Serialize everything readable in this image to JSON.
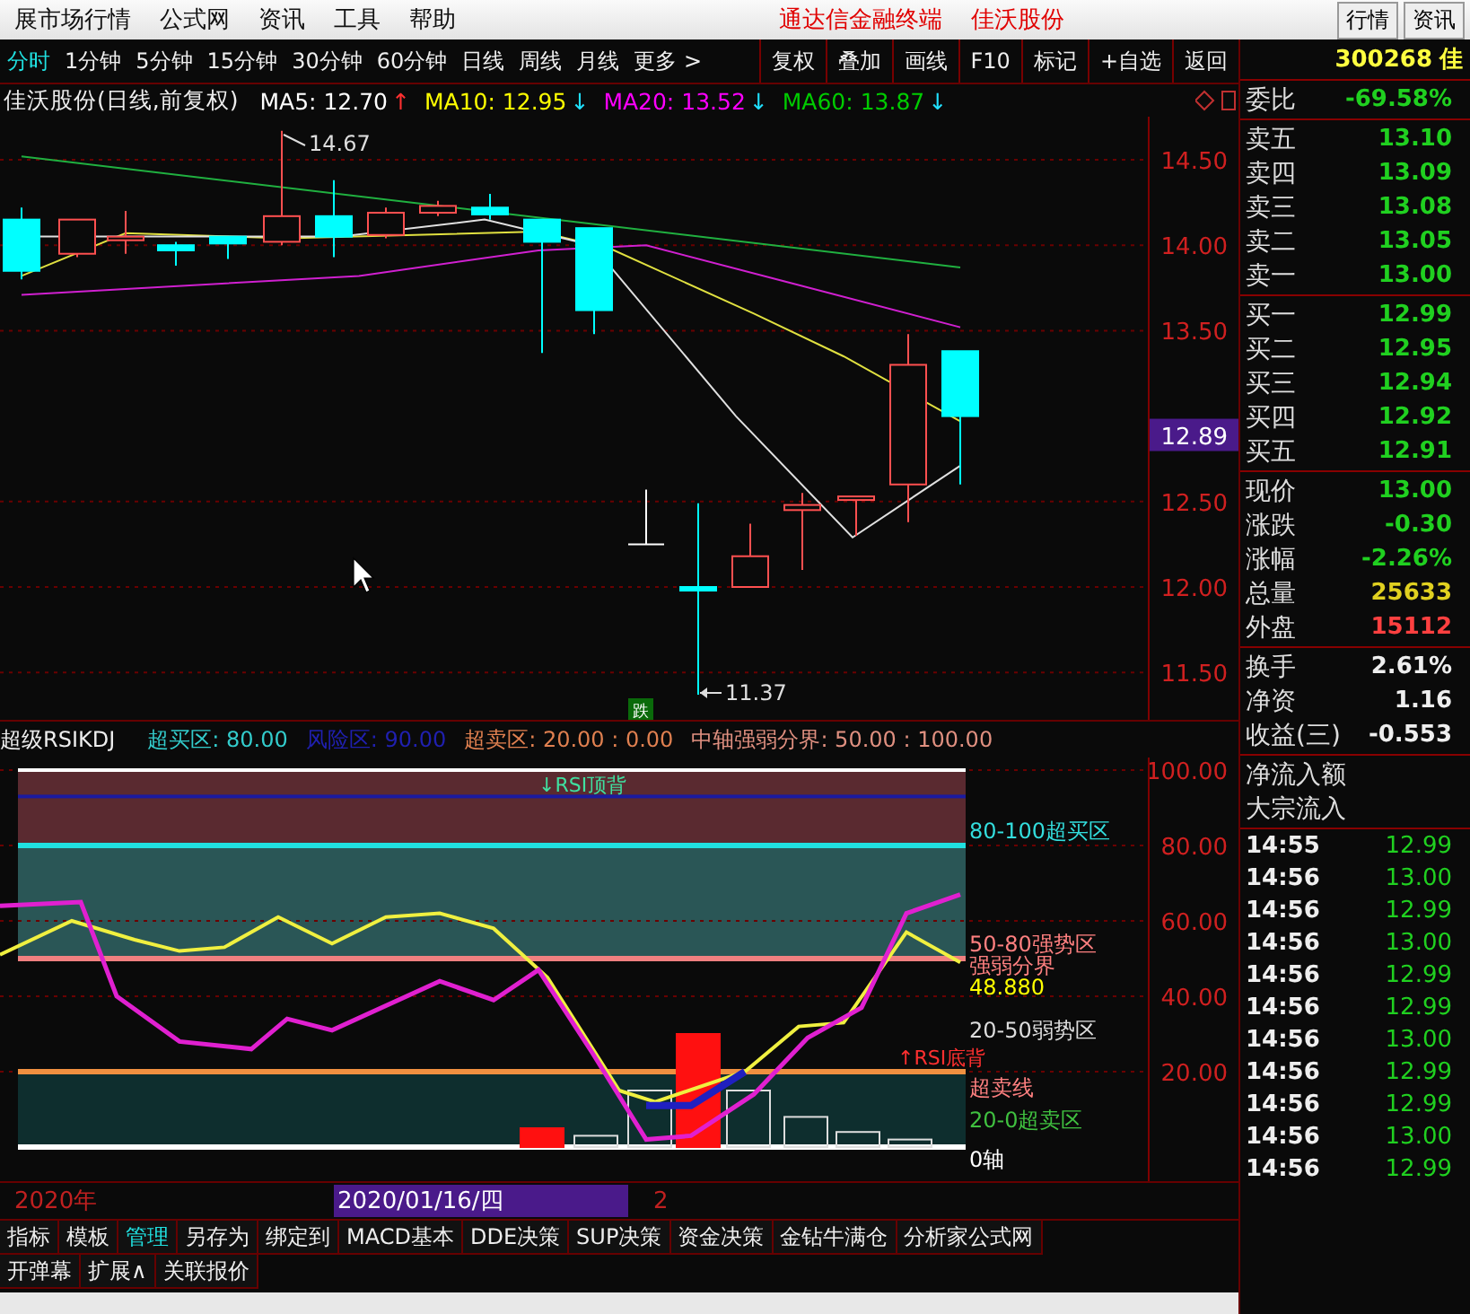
{
  "menu": {
    "items": [
      "展市场行情",
      "公式网",
      "资讯",
      "工具",
      "帮助"
    ],
    "title_parts": [
      "通达信金融终端",
      "佳沃股份"
    ],
    "right_buttons": [
      "行情",
      "资讯"
    ]
  },
  "toolbar": {
    "periods": [
      {
        "label": "分时",
        "selected": true
      },
      {
        "label": "1分钟",
        "selected": false
      },
      {
        "label": "5分钟",
        "selected": false
      },
      {
        "label": "15分钟",
        "selected": false
      },
      {
        "label": "30分钟",
        "selected": false
      },
      {
        "label": "60分钟",
        "selected": false
      },
      {
        "label": "日线",
        "selected": false
      },
      {
        "label": "周线",
        "selected": false
      },
      {
        "label": "月线",
        "selected": false
      },
      {
        "label": "更多 >",
        "selected": false
      }
    ],
    "buttons": [
      "复权",
      "叠加",
      "画线",
      "F10",
      "标记",
      "+自选",
      "返回"
    ]
  },
  "chart_header": {
    "title": "佳沃股份(日线,前复权)",
    "mas": [
      {
        "label": "MA5: 12.70",
        "color": "#ffffff",
        "arrow": {
          "text": "↑",
          "color": "#ff3030"
        }
      },
      {
        "label": "MA10: 12.95",
        "color": "#ffff00",
        "arrow": {
          "text": "↓",
          "color": "#20e0ff"
        }
      },
      {
        "label": "MA20: 13.52",
        "color": "#ff00ff",
        "arrow": {
          "text": "↓",
          "color": "#20e0ff"
        }
      },
      {
        "label": "MA60: 13.87",
        "color": "#00cc00",
        "arrow": {
          "text": "↓",
          "color": "#20e0ff"
        }
      }
    ]
  },
  "main_chart": {
    "price_axis": [
      "14.50",
      "14.00",
      "13.50",
      "12.50",
      "12.00",
      "11.50"
    ],
    "current_price": "12.89",
    "high_label": "14.67",
    "low_label": "11.37",
    "signal_badge": "跌"
  },
  "indicator": {
    "name": "超级RSIKDJ",
    "params": [
      {
        "text": "超买区: 80.00",
        "color": "#33cccc"
      },
      {
        "text": "风险区: 90.00",
        "color": "#2020b0"
      },
      {
        "text": "超卖区: 20.00 : 0.00",
        "color": "#e08050"
      },
      {
        "text": "中轴强弱分界: 50.00 : 100.00",
        "color": "#e09080"
      }
    ],
    "axis": [
      "100.00",
      "80.00",
      "60.00",
      "40.00",
      "20.00"
    ],
    "zone_labels": [
      {
        "text": "80-100超买区",
        "color": "#33dddd"
      },
      {
        "text": "50-80强势区",
        "color": "#ff8080"
      },
      {
        "text": "强弱分界",
        "color": "#ff8080"
      },
      {
        "text": "48.880",
        "color": "#ffff00"
      },
      {
        "text": "20-50弱势区",
        "color": "#dddddd"
      },
      {
        "text": "超卖线",
        "color": "#ff8080"
      },
      {
        "text": "20-0超卖区",
        "color": "#40c040"
      },
      {
        "text": "0轴",
        "color": "#ffffff"
      }
    ],
    "signals": [
      {
        "text": "↓RSI顶背",
        "kind": "top"
      },
      {
        "text": "↑RSI底背",
        "kind": "bottom"
      }
    ]
  },
  "date_bar": {
    "year": "2020年",
    "cursor_date": "2020/01/16/四",
    "mark": "2"
  },
  "bottom_tabs": [
    [
      {
        "label": "指标",
        "selected": false
      },
      {
        "label": "模板",
        "selected": false
      },
      {
        "label": "管理",
        "selected": true
      },
      {
        "label": "另存为",
        "selected": false
      },
      {
        "label": "绑定到",
        "selected": false
      },
      {
        "label": "MACD基本",
        "selected": false
      },
      {
        "label": "DDE决策",
        "selected": false
      },
      {
        "label": "SUP决策",
        "selected": false
      },
      {
        "label": "资金决策",
        "selected": false
      },
      {
        "label": "金钻牛满仓",
        "selected": false
      },
      {
        "label": "分析家公式网",
        "selected": false
      }
    ],
    [
      {
        "label": "开弹幕",
        "selected": false
      },
      {
        "label": "扩展∧",
        "selected": false
      },
      {
        "label": "关联报价",
        "selected": false
      }
    ]
  ],
  "quote_panel": {
    "code": "300268",
    "name": "佳",
    "ratio": {
      "label": "委比",
      "value": "-69.58%"
    },
    "sell": [
      {
        "label": "卖五",
        "price": "13.10"
      },
      {
        "label": "卖四",
        "price": "13.09"
      },
      {
        "label": "卖三",
        "price": "13.08"
      },
      {
        "label": "卖二",
        "price": "13.05"
      },
      {
        "label": "卖一",
        "price": "13.00"
      }
    ],
    "buy": [
      {
        "label": "买一",
        "price": "12.99"
      },
      {
        "label": "买二",
        "price": "12.95"
      },
      {
        "label": "买三",
        "price": "12.94"
      },
      {
        "label": "买四",
        "price": "12.92"
      },
      {
        "label": "买五",
        "price": "12.91"
      }
    ],
    "stats": [
      {
        "label": "现价",
        "value": "13.00",
        "color": "#20d020"
      },
      {
        "label": "涨跌",
        "value": "-0.30",
        "color": "#20d020"
      },
      {
        "label": "涨幅",
        "value": "-2.26%",
        "color": "#20d020"
      },
      {
        "label": "总量",
        "value": "25633",
        "color": "#e0d020"
      },
      {
        "label": "外盘",
        "value": "15112",
        "color": "#ff4040"
      }
    ],
    "finance": [
      {
        "label": "换手",
        "value": "2.61%"
      },
      {
        "label": "净资",
        "value": "1.16"
      },
      {
        "label": "收益(三)",
        "value": "-0.553"
      }
    ],
    "flow_labels": [
      "净流入额",
      "大宗流入"
    ],
    "trades": [
      {
        "time": "14:55",
        "price": "12.99"
      },
      {
        "time": "14:56",
        "price": "13.00"
      },
      {
        "time": "14:56",
        "price": "12.99"
      },
      {
        "time": "14:56",
        "price": "13.00"
      },
      {
        "time": "14:56",
        "price": "12.99"
      },
      {
        "time": "14:56",
        "price": "12.99"
      },
      {
        "time": "14:56",
        "price": "13.00"
      },
      {
        "time": "14:56",
        "price": "12.99"
      },
      {
        "time": "14:56",
        "price": "12.99"
      },
      {
        "time": "14:56",
        "price": "13.00"
      },
      {
        "time": "14:56",
        "price": "12.99"
      }
    ]
  }
}
